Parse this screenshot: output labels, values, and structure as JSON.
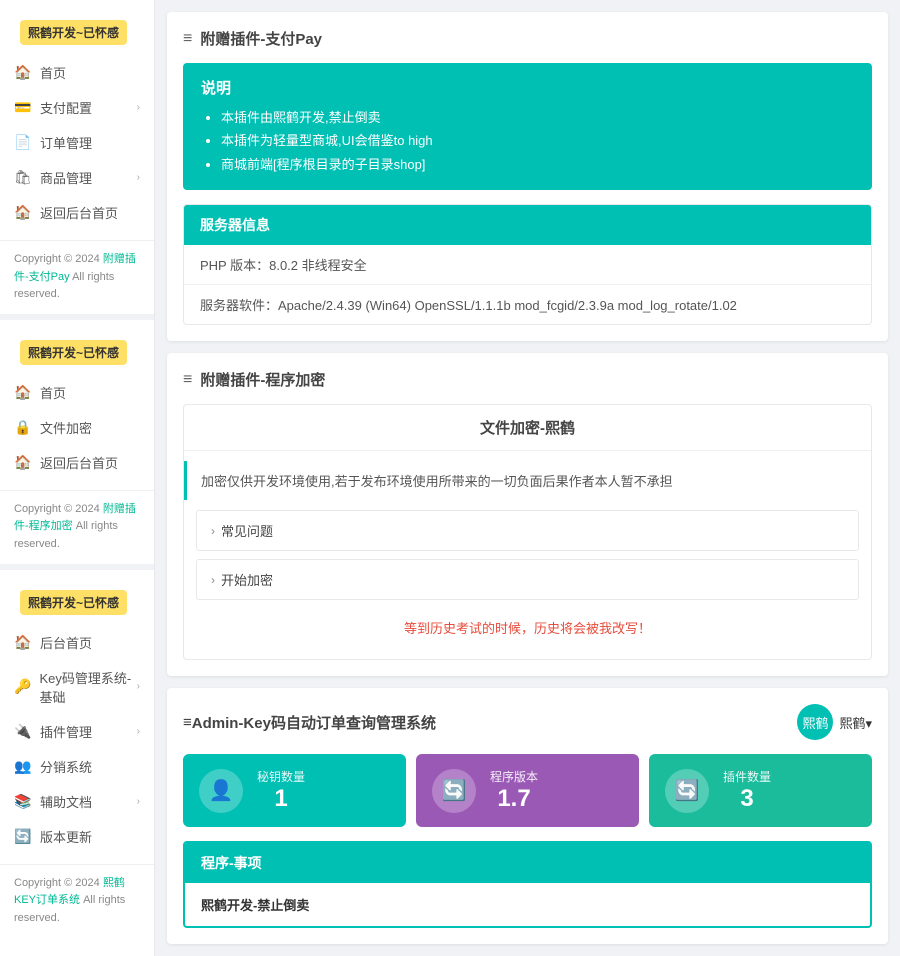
{
  "sidebars": [
    {
      "logo": "熙鹤开发~已怀感",
      "menu": [
        {
          "icon": "🏠",
          "label": "首页",
          "arrow": false
        },
        {
          "icon": "💳",
          "label": "支付配置",
          "arrow": true
        },
        {
          "icon": "📄",
          "label": "订单管理",
          "arrow": false
        },
        {
          "icon": "🛍",
          "label": "商品管理",
          "arrow": true
        },
        {
          "icon": "🏠",
          "label": "返回后台首页",
          "arrow": false
        }
      ],
      "copyright": "Copyright © 2024 ",
      "copyright_link": "附赠插件-支付Pay",
      "copyright_suffix": " All rights reserved."
    },
    {
      "logo": "熙鹤开发~已怀感",
      "menu": [
        {
          "icon": "🏠",
          "label": "首页",
          "arrow": false
        },
        {
          "icon": "🔒",
          "label": "文件加密",
          "arrow": false
        },
        {
          "icon": "🏠",
          "label": "返回后台首页",
          "arrow": false
        }
      ],
      "copyright": "Copyright © 2024 ",
      "copyright_link": "附赠插件-程序加密",
      "copyright_suffix": " All rights reserved."
    },
    {
      "logo": "熙鹤开发~已怀感",
      "menu": [
        {
          "icon": "🏠",
          "label": "后台首页",
          "arrow": false
        },
        {
          "icon": "🔑",
          "label": "Key码管理系统-基础",
          "arrow": true
        },
        {
          "icon": "🔌",
          "label": "插件管理",
          "arrow": true
        },
        {
          "icon": "👥",
          "label": "分销系统",
          "arrow": false
        },
        {
          "icon": "📚",
          "label": "辅助文档",
          "arrow": true
        },
        {
          "icon": "🔄",
          "label": "版本更新",
          "arrow": false
        }
      ],
      "copyright": "Copyright © 2024 ",
      "copyright_link": "熙鹤KEY订单系统",
      "copyright_suffix": " All rights reserved."
    }
  ],
  "panels": {
    "plugin_pay": {
      "title": "附赠插件-支付Pay",
      "info_box": {
        "heading": "说明",
        "items": [
          "本插件由熙鹤开发,禁止倒卖",
          "本插件为轻量型商城,UI会借鉴to high",
          "商城前端[程序根目录的子目录shop]"
        ]
      },
      "server_info": {
        "title": "服务器信息",
        "rows": [
          "PHP 版本：8.0.2 非线程安全",
          "服务器软件：Apache/2.4.39 (Win64) OpenSSL/1.1.1b mod_fcgid/2.3.9a mod_log_rotate/1.02"
        ]
      }
    },
    "plugin_encrypt": {
      "title": "附赠插件-程序加密",
      "file_encrypt": {
        "heading": "文件加密-熙鹤",
        "warning": "加密仅供开发环境使用,若于发布环境使用所带来的一切负面后果作者本人暂不承担",
        "faq_label": "常见问题",
        "start_label": "开始加密",
        "alert": "等到历史考试的时候，历史将会被我改写！"
      }
    },
    "admin_key": {
      "title": "Admin-Key码自动订单查询管理系统",
      "user": {
        "avatar_text": "熙鹤",
        "dropdown_label": "熙鹤▾"
      },
      "stats": [
        {
          "icon": "👤",
          "label": "秘钥数量",
          "value": "1",
          "color": "teal"
        },
        {
          "icon": "🔄",
          "label": "程序版本",
          "value": "1.7",
          "color": "purple"
        },
        {
          "icon": "🔄",
          "label": "插件数量",
          "value": "3",
          "color": "teal2"
        }
      ],
      "program_items": {
        "header": "程序-事项",
        "body": "熙鹤开发-禁止倒卖"
      }
    }
  }
}
